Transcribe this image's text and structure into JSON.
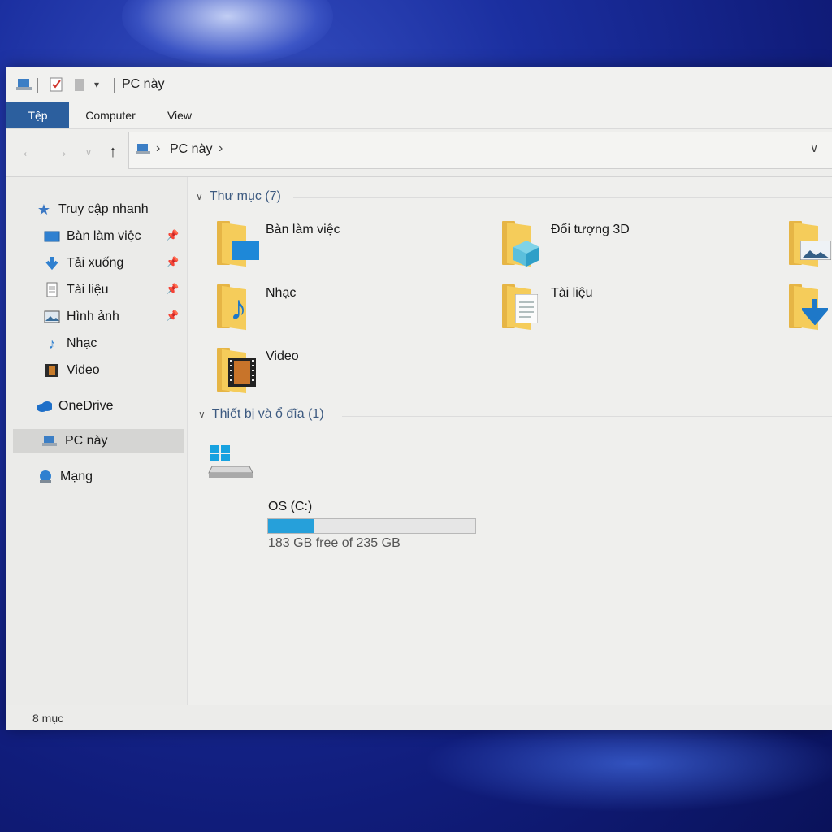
{
  "window": {
    "title": "PC này",
    "tabs": [
      "Tệp",
      "Computer",
      "View"
    ]
  },
  "address": {
    "path": "PC này"
  },
  "sidebar": {
    "quick_access": "Truy cập nhanh",
    "items": [
      {
        "label": "Bàn làm việc",
        "icon": "desktop-icon",
        "pinned": true
      },
      {
        "label": "Tải xuống",
        "icon": "download-icon",
        "pinned": true
      },
      {
        "label": "Tài liệu",
        "icon": "document-icon",
        "pinned": true
      },
      {
        "label": "Hình ảnh",
        "icon": "picture-icon",
        "pinned": true
      },
      {
        "label": "Nhạc",
        "icon": "music-icon",
        "pinned": false
      },
      {
        "label": "Video",
        "icon": "video-icon",
        "pinned": false
      }
    ],
    "onedrive": "OneDrive",
    "this_pc": "PC này",
    "network": "Mạng"
  },
  "content": {
    "folders_header": "Thư mục (7)",
    "folders": [
      {
        "label": "Bàn làm việc",
        "icon": "desktop-folder-icon"
      },
      {
        "label": "Đối tượng 3D",
        "icon": "3d-objects-folder-icon"
      },
      {
        "label": "",
        "icon": "pictures-folder-icon"
      },
      {
        "label": "Nhạc",
        "icon": "music-folder-icon"
      },
      {
        "label": "Tài liệu",
        "icon": "documents-folder-icon"
      },
      {
        "label": "",
        "icon": "downloads-folder-icon"
      },
      {
        "label": "Video",
        "icon": "videos-folder-icon"
      }
    ],
    "devices_header": "Thiết bị và ổ đĩa (1)",
    "drive": {
      "label": "OS (C:)",
      "free_text": "183 GB free of 235 GB",
      "used_fraction": 0.221
    }
  },
  "status": {
    "count": "8 mục"
  },
  "colors": {
    "accent": "#2c5f9e",
    "drive_bar": "#26a0da",
    "folder": "#f5cc5a"
  }
}
